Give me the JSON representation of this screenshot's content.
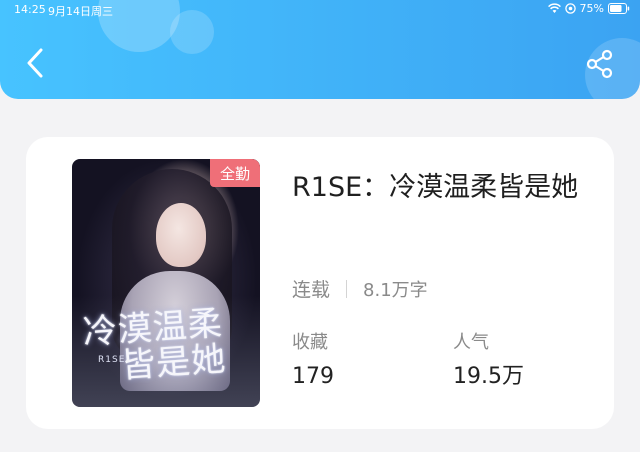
{
  "status_bar": {
    "time": "14:25",
    "date": "9月14日周三",
    "battery": "75%"
  },
  "header": {
    "back_icon": "chevron-left-icon",
    "share_icon": "share-icon",
    "color_start": "#47c3ff",
    "color_end": "#3ba3f2"
  },
  "book": {
    "title": "R1SE：冷漠温柔皆是她",
    "badge": "全勤",
    "badge_color": "#ef6f78",
    "cover": {
      "title_line1": "冷漠温柔",
      "title_line2": "皆是她",
      "subtitle": "R1SE"
    },
    "status": "连载",
    "word_count": "8.1万字",
    "stats": {
      "collect_label": "收藏",
      "collect_value": "179",
      "popularity_label": "人气",
      "popularity_value": "19.5万"
    }
  }
}
